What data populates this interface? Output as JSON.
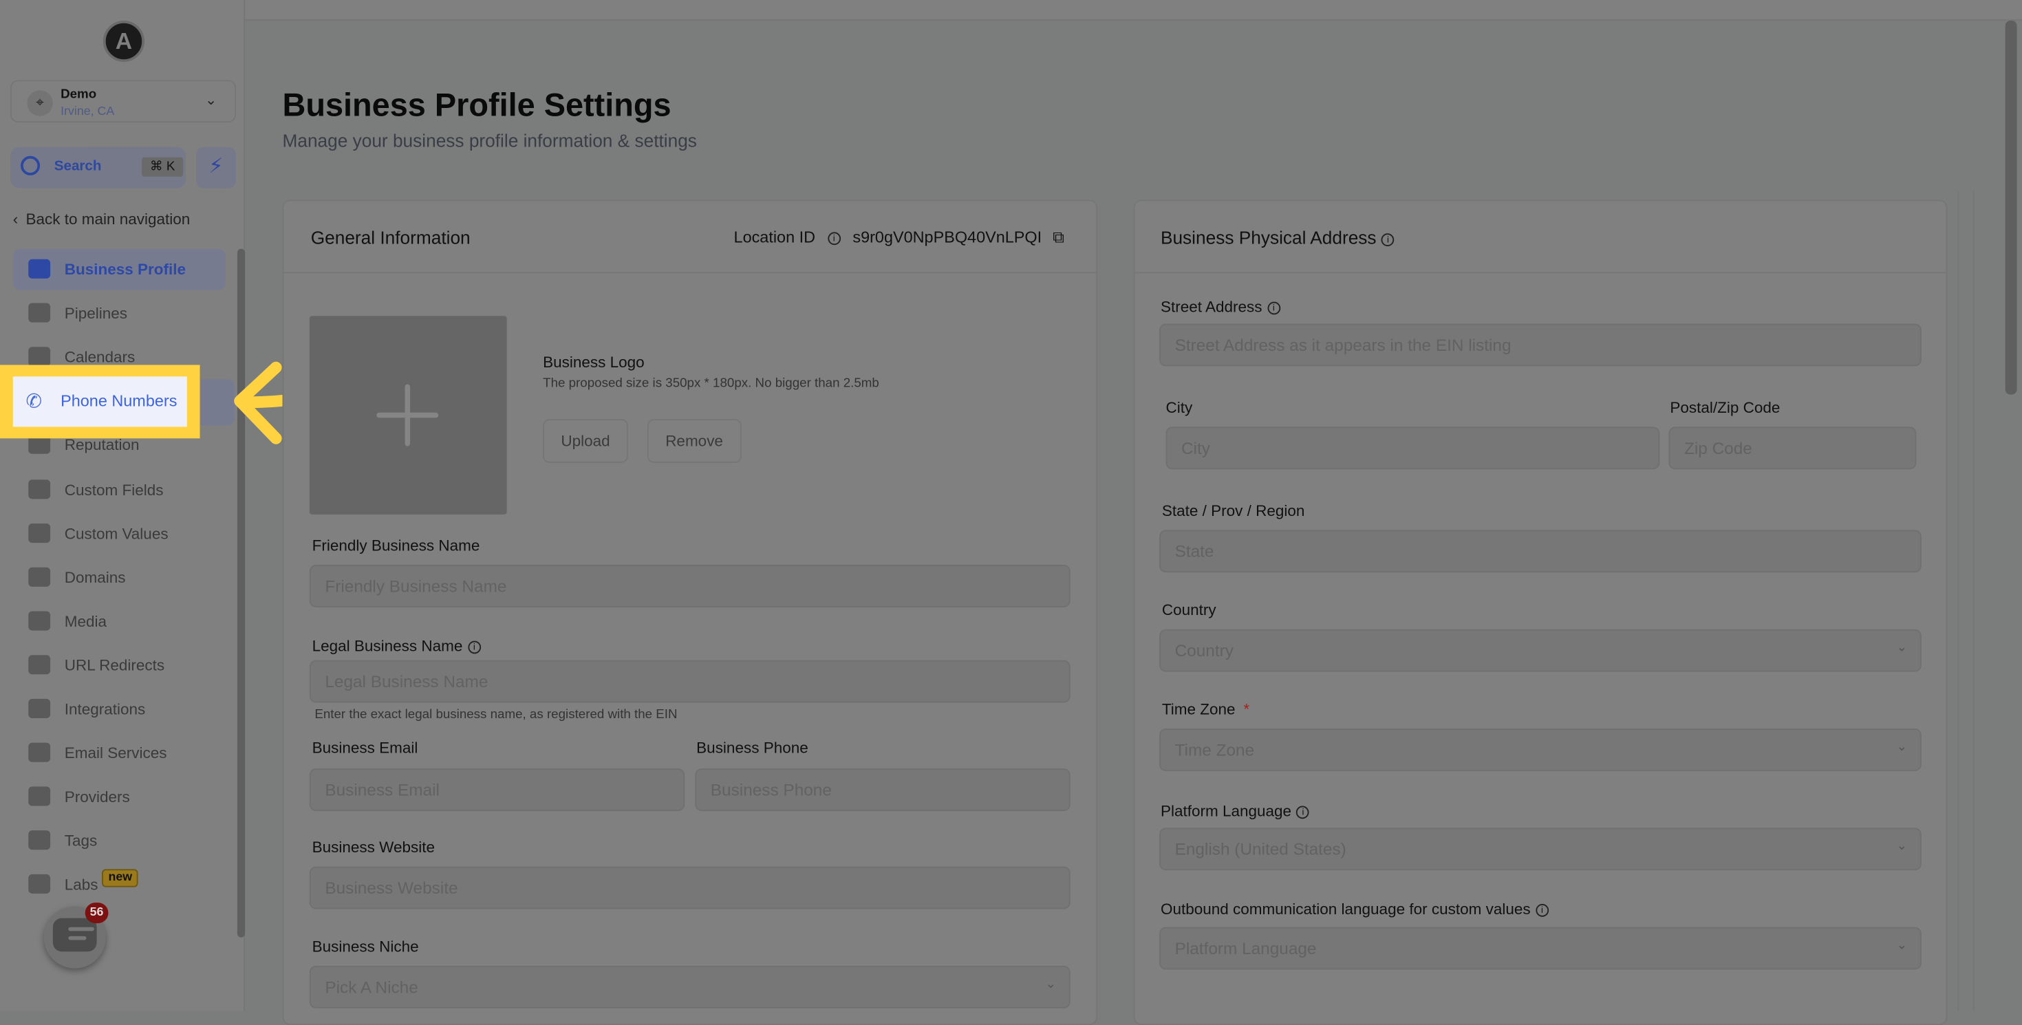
{
  "colors": {
    "accent": "#3d63dd",
    "highlight": "#ffd242",
    "badge": "#7c1111",
    "required": "#c0392b"
  },
  "sidebar": {
    "logo_letter": "A",
    "location": {
      "name": "Demo",
      "city": "Irvine, CA"
    },
    "search": {
      "label": "Search",
      "shortcut": "⌘ K"
    },
    "back_label": "Back to main navigation",
    "items": [
      {
        "label": "Business Profile",
        "icon": "briefcase-icon",
        "active": true
      },
      {
        "label": "Pipelines",
        "icon": "funnel-icon"
      },
      {
        "label": "Calendars",
        "icon": "calendar-icon"
      },
      {
        "label": "Phone Numbers",
        "icon": "phone-icon",
        "highlighted": true
      },
      {
        "label": "Reputation",
        "icon": "star-icon"
      },
      {
        "label": "Custom Fields",
        "icon": "fields-icon"
      },
      {
        "label": "Custom Values",
        "icon": "diamond-icon"
      },
      {
        "label": "Domains",
        "icon": "globe-icon"
      },
      {
        "label": "Media",
        "icon": "camera-icon"
      },
      {
        "label": "URL Redirects",
        "icon": "redirect-icon"
      },
      {
        "label": "Integrations",
        "icon": "integrations-icon"
      },
      {
        "label": "Email Services",
        "icon": "email-icon"
      },
      {
        "label": "Providers",
        "icon": "clipboard-icon"
      },
      {
        "label": "Tags",
        "icon": "tag-icon"
      },
      {
        "label": "Labs",
        "icon": "flask-icon",
        "badge": "new"
      }
    ],
    "chat_badge": "56"
  },
  "header": {
    "title": "Business Profile Settings",
    "subtitle": "Manage your business profile information & settings"
  },
  "general": {
    "title": "General Information",
    "location_id_label": "Location ID",
    "location_id": "s9r0gV0NpPBQ40VnLPQI",
    "logo_label": "Business Logo",
    "logo_hint": "The proposed size is 350px * 180px. No bigger than 2.5mb",
    "upload": "Upload",
    "remove": "Remove",
    "friendly_label": "Friendly Business Name",
    "friendly_ph": "Friendly Business Name",
    "legal_label": "Legal Business Name",
    "legal_ph": "Legal Business Name",
    "legal_help": "Enter the exact legal business name, as registered with the EIN",
    "email_label": "Business Email",
    "email_ph": "Business Email",
    "phone_label": "Business Phone",
    "phone_ph": "Business Phone",
    "website_label": "Business Website",
    "website_ph": "Business Website",
    "niche_label": "Business Niche",
    "niche_ph": "Pick A Niche"
  },
  "address": {
    "title": "Business Physical Address",
    "street_label": "Street Address",
    "street_ph": "Street Address as it appears in the EIN listing",
    "city_label": "City",
    "city_ph": "City",
    "zip_label": "Postal/Zip Code",
    "zip_ph": "Zip Code",
    "state_label": "State / Prov / Region",
    "state_ph": "State",
    "country_label": "Country",
    "country_ph": "Country",
    "tz_label": "Time Zone",
    "tz_required": "*",
    "tz_ph": "Time Zone",
    "lang_label": "Platform Language",
    "lang_value": "English (United States)",
    "outbound_label": "Outbound communication language for custom values",
    "outbound_ph": "Platform Language"
  }
}
